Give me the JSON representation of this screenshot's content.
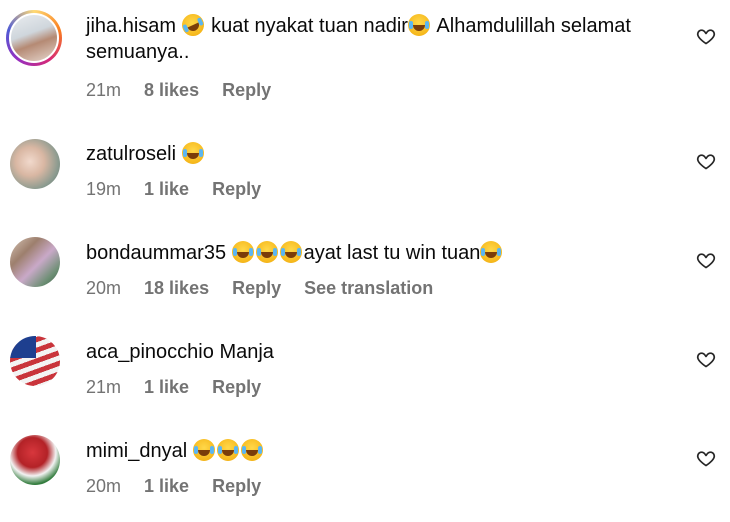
{
  "comments": [
    {
      "username": "jiha.hisam",
      "text_parts": [
        "kuat nyakat tuan nadir",
        "Alhamdulillah selamat semuanya.."
      ],
      "time": "21m",
      "likes": "8 likes",
      "reply": "Reply",
      "translation": ""
    },
    {
      "username": "zatulroseli",
      "text_parts": [],
      "time": "19m",
      "likes": "1 like",
      "reply": "Reply",
      "translation": ""
    },
    {
      "username": "bondaummar35",
      "text_parts": [
        "ayat last tu win tuan"
      ],
      "time": "20m",
      "likes": "18 likes",
      "reply": "Reply",
      "translation": "See translation"
    },
    {
      "username": "aca_pinocchio",
      "text_parts": [
        "Manja"
      ],
      "time": "21m",
      "likes": "1 like",
      "reply": "Reply",
      "translation": ""
    },
    {
      "username": "mimi_dnyal",
      "text_parts": [],
      "time": "20m",
      "likes": "1 like",
      "reply": "Reply",
      "translation": ""
    }
  ],
  "icons": {
    "like": "heart-outline-icon",
    "emoji_laugh": "face-with-tears-of-joy-emoji",
    "emoji_rofl": "rolling-on-floor-laughing-emoji"
  },
  "colors": {
    "meta_text": "#737373",
    "primary_text": "#0a0a0a"
  }
}
